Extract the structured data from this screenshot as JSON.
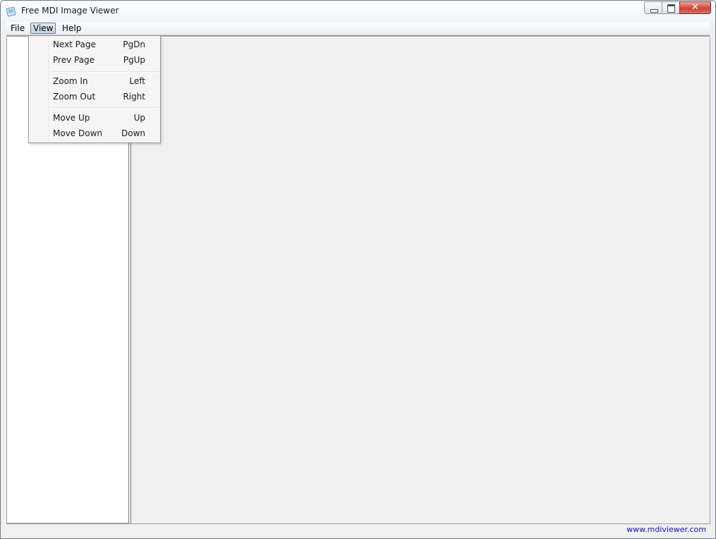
{
  "window": {
    "title": "Free MDI Image Viewer",
    "icon": "app-image-icon",
    "buttons": {
      "minimize": "minimize-icon",
      "maximize": "maximize-icon",
      "close_symbol": "✕"
    }
  },
  "menubar": {
    "items": [
      {
        "label": "File"
      },
      {
        "label": "View",
        "state": "open"
      },
      {
        "label": "Help"
      }
    ]
  },
  "view_menu": {
    "items": [
      {
        "label": "Next Page",
        "shortcut": "PgDn"
      },
      {
        "label": "Prev Page",
        "shortcut": "PgUp"
      },
      {
        "label": "Zoom In",
        "shortcut": "Left"
      },
      {
        "label": "Zoom Out",
        "shortcut": "Right"
      },
      {
        "label": "Move Up",
        "shortcut": "Up"
      },
      {
        "label": "Move Down",
        "shortcut": "Down"
      }
    ]
  },
  "statusbar": {
    "link": "www.mdiviewer.com"
  },
  "colors": {
    "link": "#1010c8",
    "close_button": "#c9453a",
    "workspace": "#f0f0f0",
    "tree_pane": "#ffffff"
  }
}
